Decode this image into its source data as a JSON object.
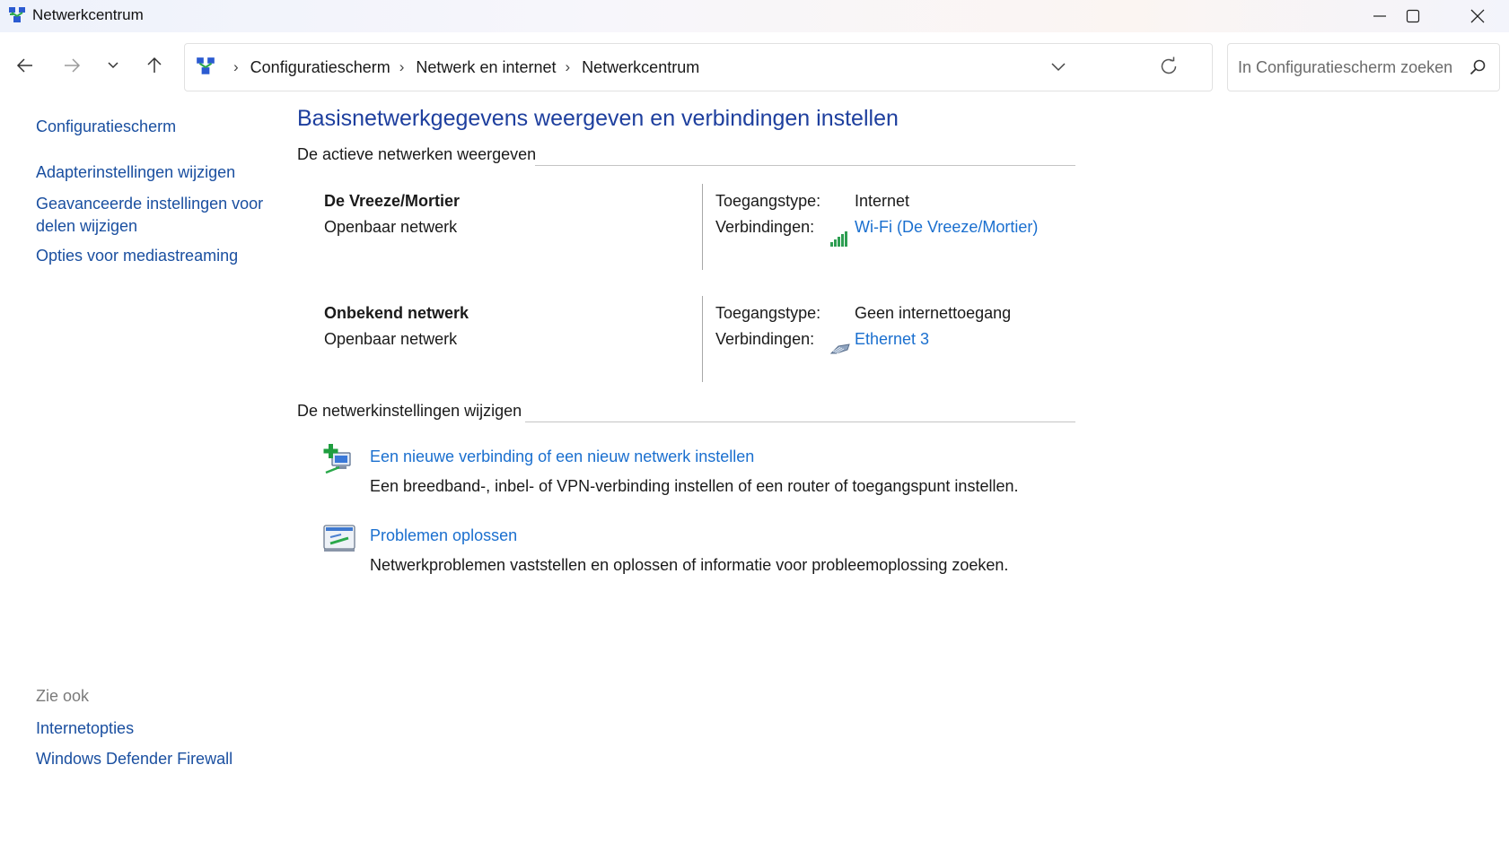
{
  "window": {
    "title": "Netwerkcentrum"
  },
  "nav": {
    "breadcrumbs": [
      "Configuratiescherm",
      "Netwerk en internet",
      "Netwerkcentrum"
    ],
    "search_placeholder": "In Configuratiescherm zoeken"
  },
  "sidebar": {
    "home": "Configuratiescherm",
    "links": [
      "Adapterinstellingen wijzigen",
      "Geavanceerde instellingen voor delen wijzigen",
      "Opties voor mediastreaming"
    ],
    "see_also_title": "Zie ook",
    "see_also": [
      "Internetopties",
      "Windows Defender Firewall"
    ]
  },
  "main": {
    "title": "Basisnetwerkgegevens weergeven en verbindingen instellen",
    "active_heading": "De actieve netwerken weergeven",
    "networks": [
      {
        "name": "De Vreeze/Mortier",
        "profile": "Openbaar netwerk",
        "access_label": "Toegangstype:",
        "access_value": "Internet",
        "conn_label": "Verbindingen:",
        "conn_link": "Wi-Fi (De Vreeze/Mortier)",
        "conn_icon": "wifi-signal-icon"
      },
      {
        "name": "Onbekend netwerk",
        "profile": "Openbaar netwerk",
        "access_label": "Toegangstype:",
        "access_value": "Geen internettoegang",
        "conn_label": "Verbindingen:",
        "conn_link": "Ethernet 3",
        "conn_icon": "ethernet-cable-icon"
      }
    ],
    "change_heading": "De netwerkinstellingen wijzigen",
    "tasks": [
      {
        "link": "Een nieuwe verbinding of een nieuw netwerk instellen",
        "desc": "Een breedband-, inbel- of VPN-verbinding instellen of een router of toegangspunt instellen.",
        "icon": "new-connection-icon"
      },
      {
        "link": "Problemen oplossen",
        "desc": "Netwerkproblemen vaststellen en oplossen of informatie voor probleemoplossing zoeken.",
        "icon": "troubleshoot-icon"
      }
    ]
  },
  "colors": {
    "link": "#1a6fcf",
    "title_blue": "#1e3f9e",
    "sidebar_link": "#1a4fa0"
  }
}
